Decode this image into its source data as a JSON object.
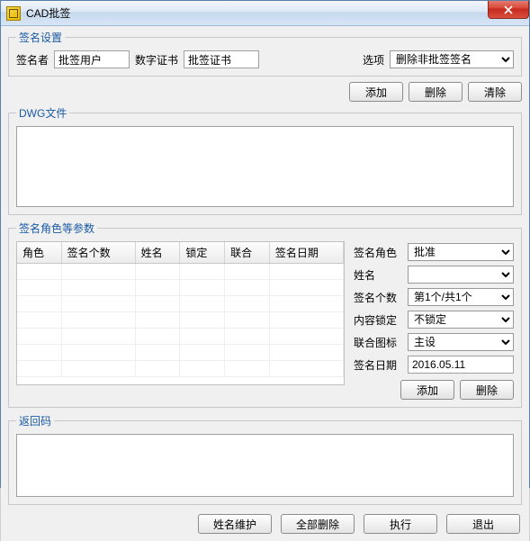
{
  "window": {
    "title": "CAD批签"
  },
  "sign_settings": {
    "legend": "签名设置",
    "signer_label": "签名者",
    "signer_value": "批签用户",
    "cert_label": "数字证书",
    "cert_value": "批签证书",
    "option_label": "选项",
    "option_value": "删除非批签签名"
  },
  "dwg": {
    "legend": "DWG文件",
    "add": "添加",
    "delete": "删除",
    "clear": "清除"
  },
  "params": {
    "legend": "签名角色等参数",
    "columns": [
      "角色",
      "签名个数",
      "姓名",
      "锁定",
      "联合",
      "签名日期"
    ],
    "side": {
      "role_label": "签名角色",
      "role_value": "批准",
      "name_label": "姓名",
      "name_value": "",
      "count_label": "签名个数",
      "count_value": "第1个/共1个",
      "lock_label": "内容锁定",
      "lock_value": "不锁定",
      "union_label": "联合图标",
      "union_value": "主设",
      "date_label": "签名日期",
      "date_value": "2016.05.11",
      "add": "添加",
      "delete": "删除"
    }
  },
  "returncode": {
    "legend": "返回码"
  },
  "bottom": {
    "name_maint": "姓名维护",
    "delete_all": "全部删除",
    "execute": "执行",
    "exit": "退出"
  }
}
